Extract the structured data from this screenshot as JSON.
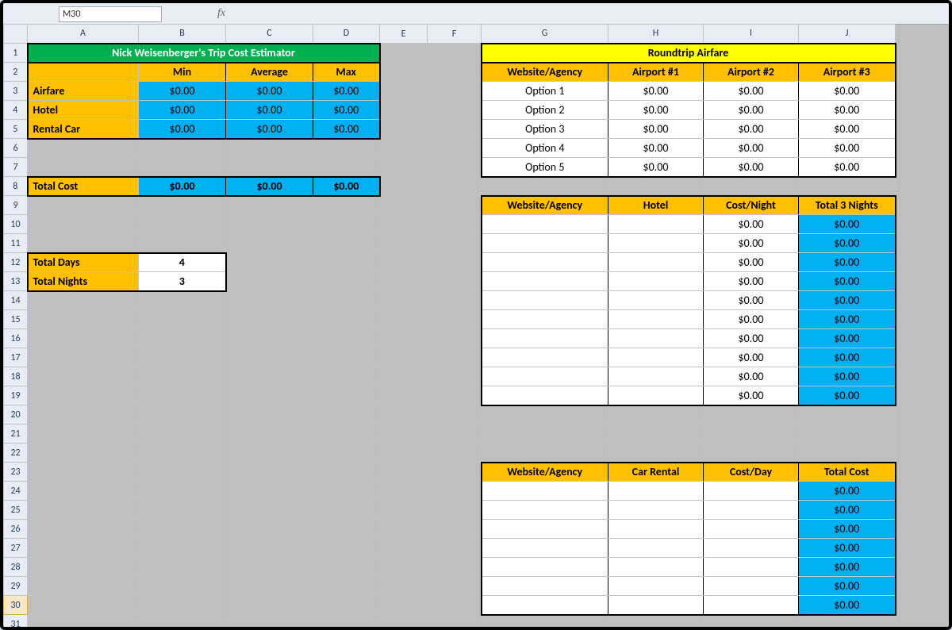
{
  "nameBox": "M30",
  "fx": "fx",
  "cols": [
    "A",
    "B",
    "C",
    "D",
    "E",
    "F",
    "G",
    "H",
    "I",
    "J"
  ],
  "rowCount": 31,
  "selectedRow": 30,
  "title": "Nick Weisenberger's Trip Cost Estimator",
  "titleAirfare": "Roundtrip Airfare",
  "hdr": {
    "min": "Min",
    "avg": "Average",
    "max": "Max"
  },
  "rowLabels": {
    "airfare": "Airfare",
    "hotel": "Hotel",
    "rental": "Rental Car",
    "total": "Total Cost",
    "days": "Total Days",
    "nights": "Total Nights"
  },
  "summary": {
    "airfare": {
      "min": "$0.00",
      "avg": "$0.00",
      "max": "$0.00"
    },
    "hotel": {
      "min": "$0.00",
      "avg": "$0.00",
      "max": "$0.00"
    },
    "rental": {
      "min": "$0.00",
      "avg": "$0.00",
      "max": "$0.00"
    },
    "total": {
      "min": "$0.00",
      "avg": "$0.00",
      "max": "$0.00"
    }
  },
  "days": "4",
  "nights": "3",
  "airHdr": {
    "g": "Website/Agency",
    "h": "Airport #1",
    "i": "Airport #2",
    "j": "Airport #3"
  },
  "airRows": [
    {
      "g": "Option 1",
      "h": "$0.00",
      "i": "$0.00",
      "j": "$0.00"
    },
    {
      "g": "Option 2",
      "h": "$0.00",
      "i": "$0.00",
      "j": "$0.00"
    },
    {
      "g": "Option 3",
      "h": "$0.00",
      "i": "$0.00",
      "j": "$0.00"
    },
    {
      "g": "Option 4",
      "h": "$0.00",
      "i": "$0.00",
      "j": "$0.00"
    },
    {
      "g": "Option 5",
      "h": "$0.00",
      "i": "$0.00",
      "j": "$0.00"
    }
  ],
  "hotelHdr": {
    "g": "Website/Agency",
    "h": "Hotel",
    "i": "Cost/Night",
    "j": "Total 3 Nights"
  },
  "hotelRows": [
    {
      "i": "$0.00",
      "j": "$0.00"
    },
    {
      "i": "$0.00",
      "j": "$0.00"
    },
    {
      "i": "$0.00",
      "j": "$0.00"
    },
    {
      "i": "$0.00",
      "j": "$0.00"
    },
    {
      "i": "$0.00",
      "j": "$0.00"
    },
    {
      "i": "$0.00",
      "j": "$0.00"
    },
    {
      "i": "$0.00",
      "j": "$0.00"
    },
    {
      "i": "$0.00",
      "j": "$0.00"
    },
    {
      "i": "$0.00",
      "j": "$0.00"
    },
    {
      "i": "$0.00",
      "j": "$0.00"
    }
  ],
  "carHdr": {
    "g": "Website/Agency",
    "h": "Car Rental",
    "i": "Cost/Day",
    "j": "Total Cost"
  },
  "carRows": [
    {
      "j": "$0.00"
    },
    {
      "j": "$0.00"
    },
    {
      "j": "$0.00"
    },
    {
      "j": "$0.00"
    },
    {
      "j": "$0.00"
    },
    {
      "j": "$0.00"
    },
    {
      "j": "$0.00"
    }
  ]
}
